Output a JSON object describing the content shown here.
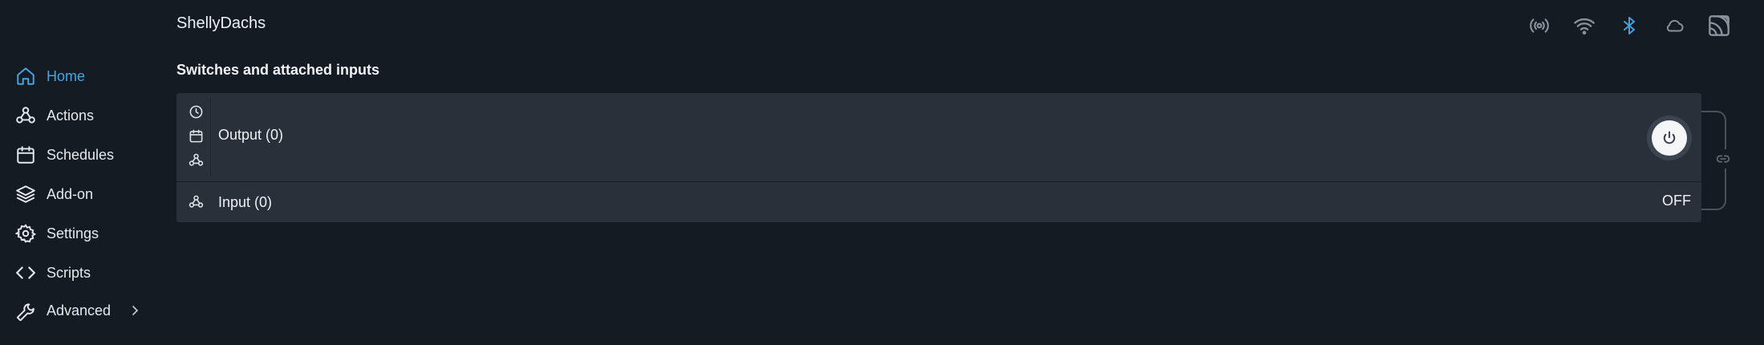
{
  "header": {
    "device_name": "ShellyDachs"
  },
  "status_icons": [
    {
      "name": "radio-signal-icon",
      "color": "#8a939d"
    },
    {
      "name": "wifi-icon",
      "color": "#8a939d"
    },
    {
      "name": "bluetooth-icon",
      "color": "#4aa3df"
    },
    {
      "name": "cloud-icon",
      "color": "#8a939d"
    },
    {
      "name": "mqtt-icon",
      "color": "#8a939d"
    }
  ],
  "sidebar": {
    "items": [
      {
        "label": "Home",
        "icon": "home-icon",
        "active": true
      },
      {
        "label": "Actions",
        "icon": "webhook-icon"
      },
      {
        "label": "Schedules",
        "icon": "calendar-icon"
      },
      {
        "label": "Add-on",
        "icon": "layers-icon"
      },
      {
        "label": "Settings",
        "icon": "gear-icon"
      },
      {
        "label": "Scripts",
        "icon": "code-icon"
      },
      {
        "label": "Advanced",
        "icon": "wrench-icon",
        "has_submenu": true
      }
    ]
  },
  "main": {
    "section_title": "Switches and attached inputs",
    "output": {
      "label": "Output (0)",
      "icons": [
        "clock-icon",
        "calendar-icon",
        "webhook-icon"
      ]
    },
    "input": {
      "label": "Input (0)",
      "state": "OFF",
      "icon": "webhook-icon"
    }
  },
  "colors": {
    "accent": "#4aa3df",
    "background": "#141b23",
    "card": "#2a3039"
  }
}
